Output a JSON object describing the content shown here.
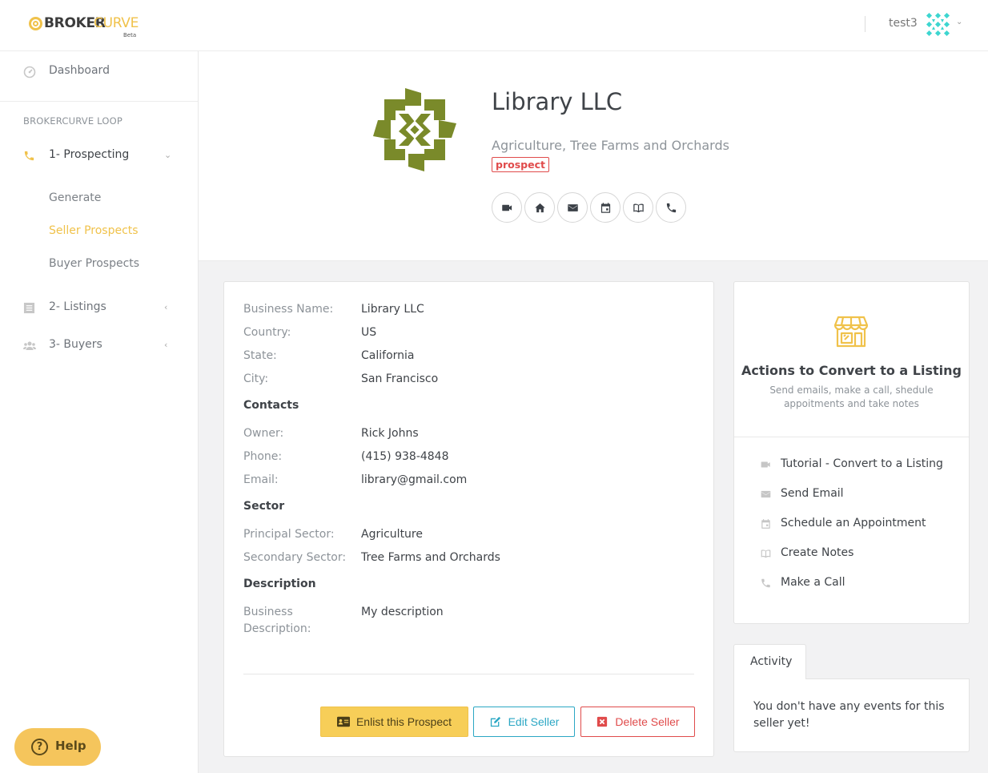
{
  "brand": {
    "word1": "BROKER",
    "word2": "CURVE",
    "tag": "Beta"
  },
  "user": {
    "name": "test3"
  },
  "sidebar": {
    "dashboard": "Dashboard",
    "section": "BROKERCURVE LOOP",
    "groups": [
      {
        "label": "1- Prospecting",
        "expanded": true
      },
      {
        "label": "2- Listings",
        "expanded": false
      },
      {
        "label": "3- Buyers",
        "expanded": false
      }
    ],
    "sub_items": [
      {
        "label": "Generate",
        "active": false
      },
      {
        "label": "Seller Prospects",
        "active": true
      },
      {
        "label": "Buyer Prospects",
        "active": false
      }
    ],
    "help": "Help"
  },
  "company": {
    "name": "Library LLC",
    "sector_line": "Agriculture, Tree Farms and Orchards",
    "status": "prospect"
  },
  "details": {
    "rows1": [
      {
        "label": "Business Name:",
        "value": "Library LLC"
      },
      {
        "label": "Country:",
        "value": "US"
      },
      {
        "label": "State:",
        "value": "California"
      },
      {
        "label": "City:",
        "value": "San Francisco"
      }
    ],
    "contacts_title": "Contacts",
    "contacts": [
      {
        "label": "Owner:",
        "value": "Rick Johns"
      },
      {
        "label": "Phone:",
        "value": "(415) 938-4848"
      },
      {
        "label": "Email:",
        "value": "library@gmail.com"
      }
    ],
    "sector_title": "Sector",
    "sector": [
      {
        "label": "Principal Sector:",
        "value": "Agriculture"
      },
      {
        "label": "Secondary Sector:",
        "value": "Tree Farms and Orchards"
      }
    ],
    "description_title": "Description",
    "description": {
      "label": "Business Description:",
      "value": "My description"
    }
  },
  "buttons": {
    "enlist": "Enlist this Prospect",
    "edit": "Edit Seller",
    "delete": "Delete Seller"
  },
  "actions_panel": {
    "title": "Actions to Convert to a Listing",
    "subtitle": "Send emails, make a call, shedule appoitments and take notes",
    "items": [
      {
        "label": "Tutorial - Convert to a Listing",
        "icon": "video-icon"
      },
      {
        "label": "Send Email",
        "icon": "email-icon"
      },
      {
        "label": "Schedule an Appointment",
        "icon": "calendar-icon"
      },
      {
        "label": "Create Notes",
        "icon": "notes-icon"
      },
      {
        "label": "Make a Call",
        "icon": "phone-icon"
      }
    ]
  },
  "activity": {
    "tab": "Activity",
    "empty": "You don't have any events for this seller yet!"
  },
  "colors": {
    "accent": "#f0c24b",
    "danger": "#e04b4b",
    "info": "#2ba7c4",
    "logo_green": "#7a8a2a"
  }
}
